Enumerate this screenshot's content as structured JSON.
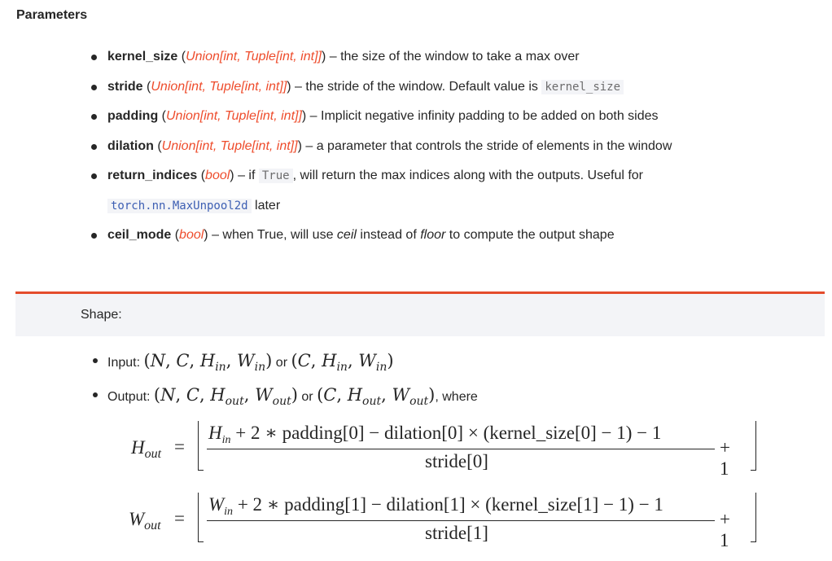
{
  "params_heading": "Parameters",
  "params": [
    {
      "name": "kernel_size",
      "type": "Union[int, Tuple[int, int]]",
      "desc": " – the size of the window to take a max over"
    },
    {
      "name": "stride",
      "type": "Union[int, Tuple[int, int]]",
      "desc": " – the stride of the window. Default value is ",
      "code": "kernel_size"
    },
    {
      "name": "padding",
      "type": "Union[int, Tuple[int, int]]",
      "desc": " – Implicit negative infinity padding to be added on both sides"
    },
    {
      "name": "dilation",
      "type": "Union[int, Tuple[int, int]]",
      "desc": " – a parameter that controls the stride of elements in the window"
    },
    {
      "name": "return_indices",
      "type": "bool",
      "desc_a": " – if ",
      "code": "True",
      "desc_b": ", will return the max indices along with the outputs. Useful for",
      "link": "torch.nn.MaxUnpool2d",
      "desc_c": " later"
    },
    {
      "name": "ceil_mode",
      "type": "bool",
      "desc_a": " – when True, will use ",
      "it1": "ceil",
      "desc_b": " instead of ",
      "it2": "floor",
      "desc_c": " to compute the output shape"
    }
  ],
  "shape_label": "Shape:",
  "shape_items": {
    "input_label": "Input: ",
    "output_label": "Output: ",
    "or": " or ",
    "where": ", where"
  },
  "formulas": {
    "h_lhs": "H",
    "h_lhs_sub": "out",
    "h_num": "H",
    "h_num_sub": "in",
    "h_num_rest": " + 2 ∗ padding[0] − dilation[0] × (kernel_size[0] − 1) − 1",
    "h_den": "stride[0]",
    "w_lhs": "W",
    "w_lhs_sub": "out",
    "w_num": "W",
    "w_num_sub": "in",
    "w_num_rest": " + 2 ∗ padding[1] − dilation[1] × (kernel_size[1] − 1) − 1",
    "w_den": "stride[1]",
    "equals": "=",
    "plus_one": "+ 1"
  },
  "colors": {
    "accent": "#ee4c2c",
    "link": "#3d5fb3",
    "shape_bg": "#f3f4f7"
  }
}
